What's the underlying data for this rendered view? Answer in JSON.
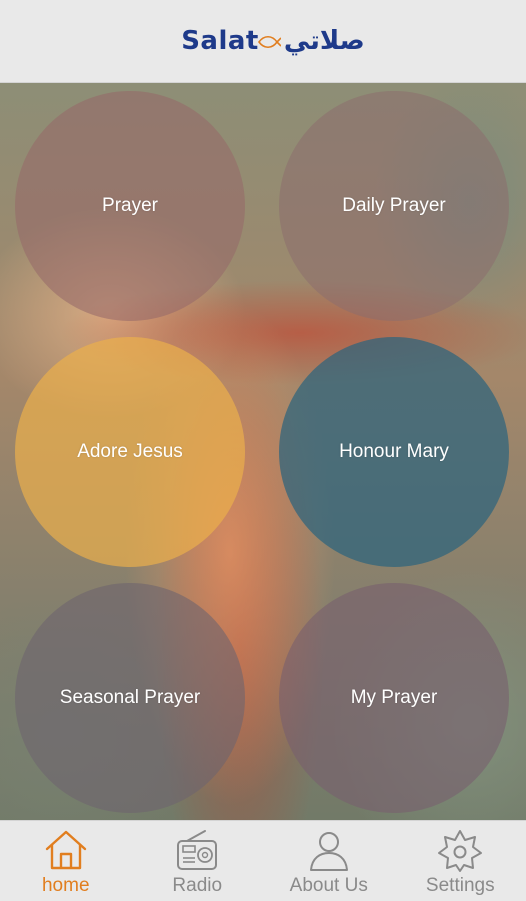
{
  "header": {
    "logo_latin": "Salat",
    "logo_arabic": "صلاتي"
  },
  "main": {
    "tiles": [
      {
        "label": "Prayer"
      },
      {
        "label": "Daily Prayer"
      },
      {
        "label": "Adore Jesus"
      },
      {
        "label": "Honour Mary"
      },
      {
        "label": "Seasonal Prayer"
      },
      {
        "label": "My Prayer"
      }
    ]
  },
  "tabbar": {
    "tabs": [
      {
        "label": "home",
        "icon": "home-icon",
        "active": true
      },
      {
        "label": "Radio",
        "icon": "radio-icon",
        "active": false
      },
      {
        "label": "About Us",
        "icon": "user-icon",
        "active": false
      },
      {
        "label": "Settings",
        "icon": "gear-icon",
        "active": false
      }
    ]
  },
  "colors": {
    "brand": "#1e3a8a",
    "active_tab": "#e17e1f",
    "inactive_tab": "#8a8a8a"
  }
}
